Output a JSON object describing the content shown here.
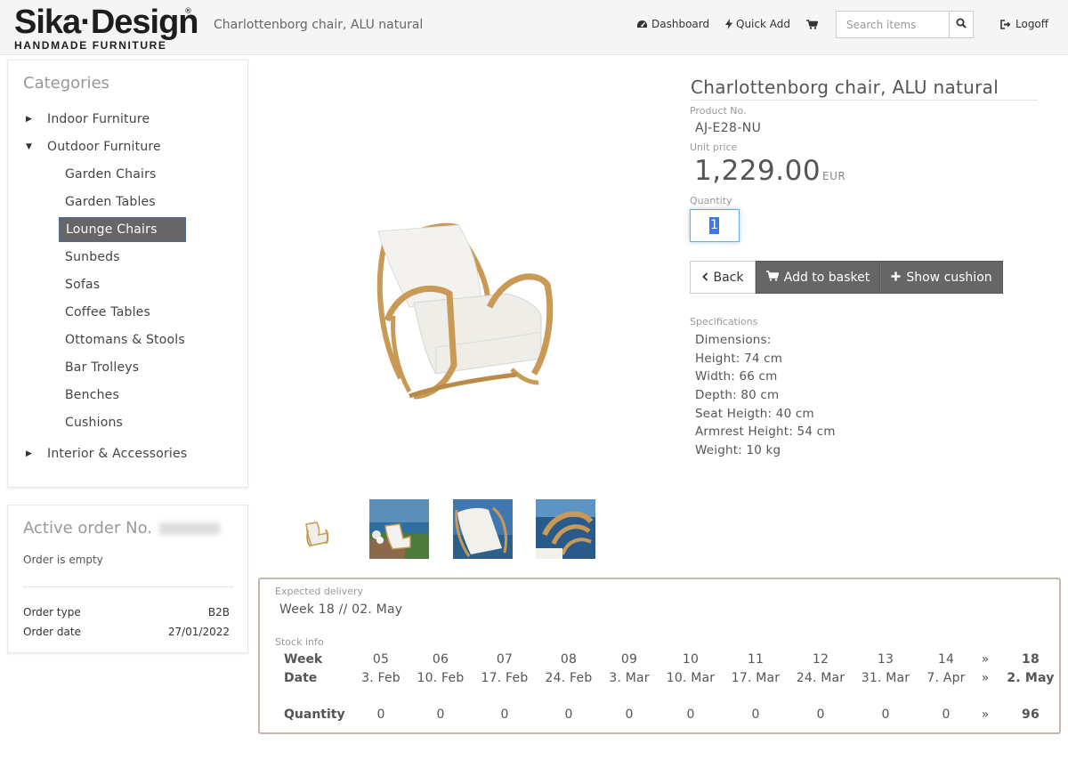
{
  "header": {
    "logo_main": "Sika·Design",
    "logo_reg": "®",
    "logo_sub": "HANDMADE FURNITURE",
    "page_title": "Charlottenborg chair, ALU natural",
    "nav": {
      "dashboard": "Dashboard",
      "quick_add": "Quick Add",
      "logoff": "Logoff"
    },
    "search": {
      "placeholder": "Search items",
      "value": ""
    }
  },
  "categories": {
    "title": "Categories",
    "top": [
      {
        "label": "Indoor Furniture",
        "expanded": false
      },
      {
        "label": "Outdoor Furniture",
        "expanded": true
      },
      {
        "label": "Interior & Accessories",
        "expanded": false
      }
    ],
    "outdoor_children": [
      {
        "label": "Garden Chairs"
      },
      {
        "label": "Garden Tables"
      },
      {
        "label": "Lounge Chairs",
        "active": true
      },
      {
        "label": "Sunbeds"
      },
      {
        "label": "Sofas"
      },
      {
        "label": "Coffee Tables"
      },
      {
        "label": "Ottomans & Stools"
      },
      {
        "label": "Bar Trolleys"
      },
      {
        "label": "Benches"
      },
      {
        "label": "Cushions"
      }
    ]
  },
  "order": {
    "title": "Active order No.",
    "status": "Order is empty",
    "type_label": "Order type",
    "type_value": "B2B",
    "date_label": "Order date",
    "date_value": "27/01/2022"
  },
  "product": {
    "title": "Charlottenborg chair, ALU natural",
    "product_no_label": "Product No.",
    "product_no": "AJ-E28-NU",
    "unit_price_label": "Unit price",
    "price": "1,229.00",
    "currency": "EUR",
    "quantity_label": "Quantity",
    "quantity": "1",
    "buttons": {
      "back": "Back",
      "add_to_basket": "Add to basket",
      "show_cushion": "Show cushion"
    },
    "specifications_label": "Specifications",
    "specifications": [
      "Dimensions:",
      "Height: 74 cm",
      "Width: 66 cm",
      "Depth: 80 cm",
      "Seat Heigth: 40 cm",
      "Armrest Height: 54 cm",
      "Weight: 10 kg"
    ]
  },
  "delivery": {
    "expected_label": "Expected delivery",
    "expected_value": "Week 18 // 02. May",
    "stock_label": "Stock info",
    "row_week": "Week",
    "row_date": "Date",
    "row_quantity": "Quantity",
    "columns": [
      {
        "week": "05",
        "date": "3. Feb",
        "qty": "0"
      },
      {
        "week": "06",
        "date": "10. Feb",
        "qty": "0"
      },
      {
        "week": "07",
        "date": "17. Feb",
        "qty": "0"
      },
      {
        "week": "08",
        "date": "24. Feb",
        "qty": "0"
      },
      {
        "week": "09",
        "date": "3. Mar",
        "qty": "0"
      },
      {
        "week": "10",
        "date": "10. Mar",
        "qty": "0"
      },
      {
        "week": "11",
        "date": "17. Mar",
        "qty": "0"
      },
      {
        "week": "12",
        "date": "24. Mar",
        "qty": "0"
      },
      {
        "week": "13",
        "date": "31. Mar",
        "qty": "0"
      },
      {
        "week": "14",
        "date": "7. Apr",
        "qty": "0"
      },
      {
        "week": "»",
        "date": "»",
        "qty": "»"
      },
      {
        "week": "18",
        "date": "2. May",
        "qty": "96",
        "bold": true
      }
    ]
  }
}
